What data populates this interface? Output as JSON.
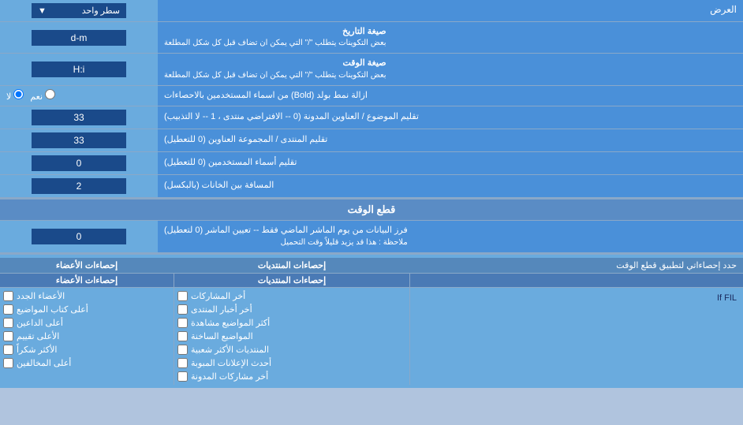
{
  "page": {
    "display_label": "العرض",
    "display_dropdown": "سطر واحد",
    "date_format_label": "صيغة التاريخ",
    "date_format_desc": "بعض التكوينات يتطلب \"/\" التي يمكن ان تضاف قبل كل شكل المطلعة",
    "date_format_value": "d-m",
    "time_format_label": "صيغة الوقت",
    "time_format_desc": "بعض التكوينات يتطلب \"/\" التي يمكن ان تضاف قبل كل شكل المطلعة",
    "time_format_value": "H:i",
    "bold_label": "ازالة نمط بولد (Bold) من اسماء المستخدمين بالاحصاءات",
    "bold_yes": "نعم",
    "bold_no": "لا",
    "topic_order_label": "تقليم الموضوع / العناوين المدونة (0 -- الافتراضي منتدى ، 1 -- لا التذبيب)",
    "topic_order_value": "33",
    "forum_order_label": "تقليم المنتدى / المجموعة العناوين (0 للتعطيل)",
    "forum_order_value": "33",
    "username_order_label": "تقليم أسماء المستخدمين (0 للتعطيل)",
    "username_order_value": "0",
    "column_gap_label": "المسافة بين الخانات (بالبكسل)",
    "column_gap_value": "2",
    "cutoff_header": "قطع الوقت",
    "cutoff_label": "فرز البيانات من يوم الماشر الماضي فقط -- تعيين الماشر (0 لتعطيل)",
    "cutoff_note": "ملاحظة : هذا قد يزيد قليلاً وقت التحميل",
    "cutoff_value": "0",
    "limit_header": "حدد إحصاءاتي لتطبيق قطع الوقت",
    "stats_col1_header": "",
    "stats_col2_header": "إحصاءات المنتديات",
    "stats_col3_header": "إحصاءات الأعضاء",
    "stats_items_col2": [
      "أخر المشاركات",
      "أخر أخبار المنتدى",
      "أكثر المواضيع مشاهدة",
      "المواضيع الساخنة",
      "المنتديات الأكثر شعبية",
      "أحدث الإعلانات المبوبة",
      "أخر مشاركات المدونة"
    ],
    "stats_items_col3": [
      "الأعضاء الجدد",
      "أعلى كتاب المواضيع",
      "أعلى الداعين",
      "الأعلى تقييم",
      "الأكثر شكراً",
      "أعلى المخالفين"
    ],
    "stats_items_col1": [
      "If FIL"
    ]
  }
}
